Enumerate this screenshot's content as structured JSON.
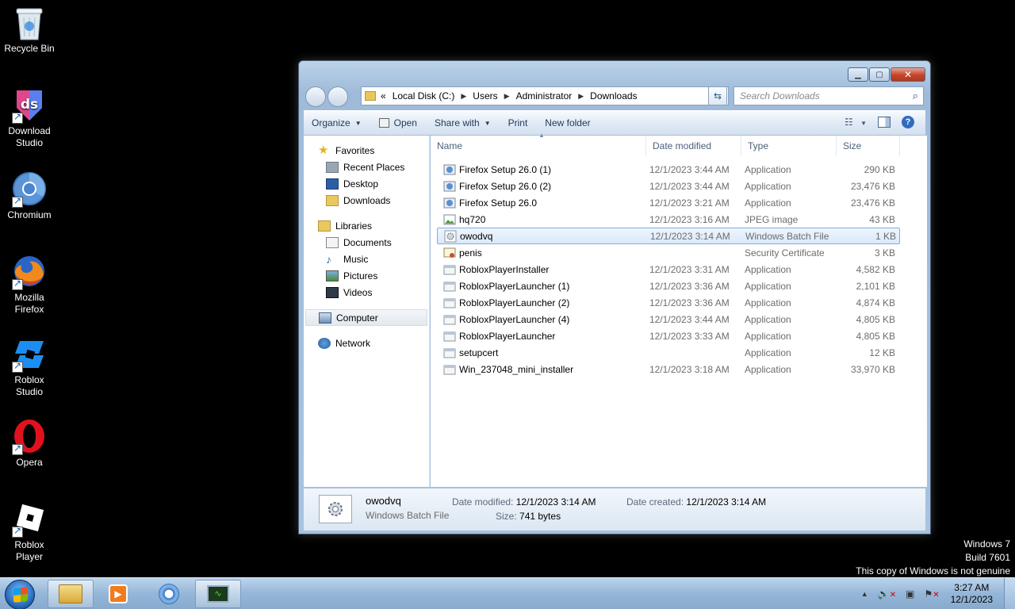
{
  "desktop": {
    "icons": [
      {
        "label": "Recycle Bin"
      },
      {
        "label": "Download Studio"
      },
      {
        "label": "Chromium"
      },
      {
        "label": "Mozilla Firefox"
      },
      {
        "label": "Roblox Studio"
      },
      {
        "label": "Opera"
      },
      {
        "label": "Roblox Player"
      }
    ]
  },
  "window": {
    "address": {
      "overflow": "«",
      "crumbs": [
        "Local Disk (C:)",
        "Users",
        "Administrator",
        "Downloads"
      ]
    },
    "search_placeholder": "Search Downloads",
    "toolbar": {
      "organize": "Organize",
      "open": "Open",
      "share_with": "Share with",
      "print": "Print",
      "new_folder": "New folder"
    },
    "nav": {
      "favorites": "Favorites",
      "recent_places": "Recent Places",
      "desktop": "Desktop",
      "downloads": "Downloads",
      "libraries": "Libraries",
      "documents": "Documents",
      "music": "Music",
      "pictures": "Pictures",
      "videos": "Videos",
      "computer": "Computer",
      "network": "Network"
    },
    "columns": {
      "name": "Name",
      "date": "Date modified",
      "type": "Type",
      "size": "Size"
    },
    "files": [
      {
        "name": "Firefox Setup 26.0 (1)",
        "date": "12/1/2023 3:44 AM",
        "type": "Application",
        "size": "290 KB"
      },
      {
        "name": "Firefox Setup 26.0 (2)",
        "date": "12/1/2023 3:44 AM",
        "type": "Application",
        "size": "23,476 KB"
      },
      {
        "name": "Firefox Setup 26.0",
        "date": "12/1/2023 3:21 AM",
        "type": "Application",
        "size": "23,476 KB"
      },
      {
        "name": "hq720",
        "date": "12/1/2023 3:16 AM",
        "type": "JPEG image",
        "size": "43 KB"
      },
      {
        "name": "owodvq",
        "date": "12/1/2023 3:14 AM",
        "type": "Windows Batch File",
        "size": "1 KB"
      },
      {
        "name": "penis",
        "date": "",
        "type": "Security Certificate",
        "size": "3 KB"
      },
      {
        "name": "RobloxPlayerInstaller",
        "date": "12/1/2023 3:31 AM",
        "type": "Application",
        "size": "4,582 KB"
      },
      {
        "name": "RobloxPlayerLauncher (1)",
        "date": "12/1/2023 3:36 AM",
        "type": "Application",
        "size": "2,101 KB"
      },
      {
        "name": "RobloxPlayerLauncher (2)",
        "date": "12/1/2023 3:36 AM",
        "type": "Application",
        "size": "4,874 KB"
      },
      {
        "name": "RobloxPlayerLauncher (4)",
        "date": "12/1/2023 3:44 AM",
        "type": "Application",
        "size": "4,805 KB"
      },
      {
        "name": "RobloxPlayerLauncher",
        "date": "12/1/2023 3:33 AM",
        "type": "Application",
        "size": "4,805 KB"
      },
      {
        "name": "setupcert",
        "date": "",
        "type": "Application",
        "size": "12 KB"
      },
      {
        "name": "Win_237048_mini_installer",
        "date": "12/1/2023 3:18 AM",
        "type": "Application",
        "size": "33,970 KB"
      }
    ],
    "details": {
      "name": "owodvq",
      "type": "Windows Batch File",
      "date_modified_label": "Date modified:",
      "date_modified": "12/1/2023 3:14 AM",
      "date_created_label": "Date created:",
      "date_created": "12/1/2023 3:14 AM",
      "size_label": "Size:",
      "size": "741 bytes"
    }
  },
  "watermark": {
    "line1": "Windows 7",
    "line2": "Build 7601",
    "line3": "This copy of Windows is not genuine"
  },
  "taskbar": {
    "time": "3:27 AM",
    "date": "12/1/2023"
  },
  "colors": {
    "selection_border": "#84acdd",
    "selection_bg": "#d9e9fb",
    "taskbar": "#95b6d8"
  }
}
